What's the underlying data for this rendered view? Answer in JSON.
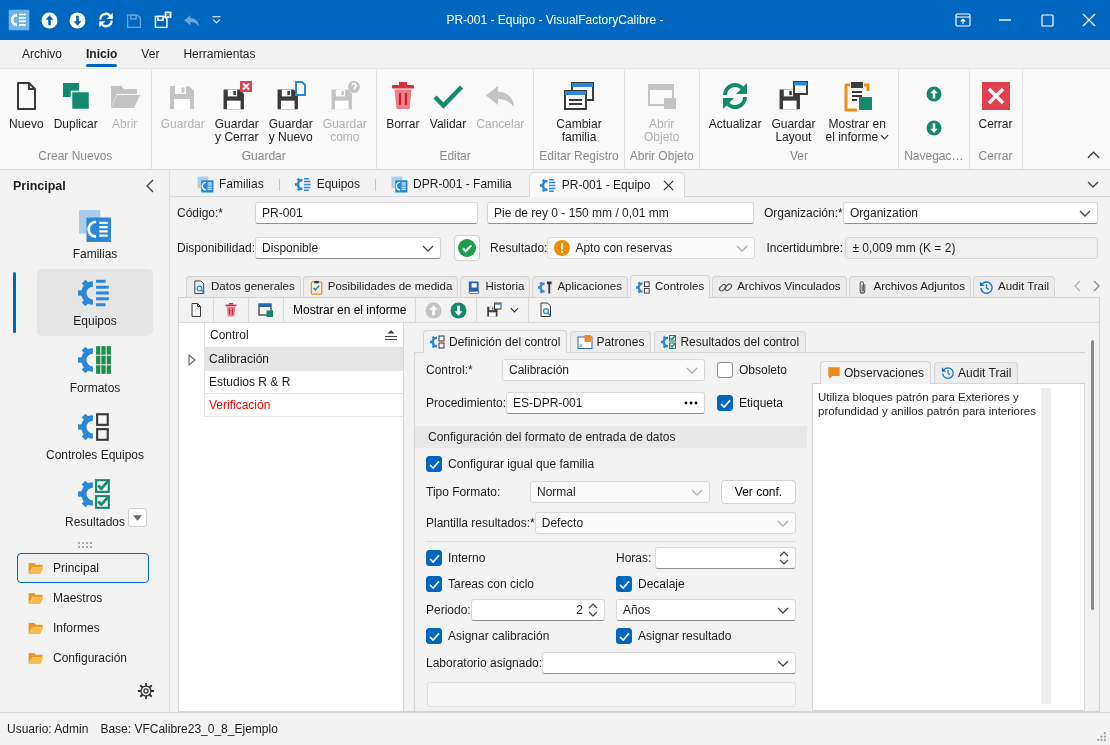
{
  "window": {
    "title": "PR-001 - Equipo - VisualFactoryCalibre -"
  },
  "quick_access": [
    {
      "kind": "app",
      "disabled": false
    },
    {
      "kind": "up",
      "disabled": false
    },
    {
      "kind": "down",
      "disabled": false
    },
    {
      "kind": "refresh",
      "disabled": false
    },
    {
      "kind": "save",
      "disabled": true
    },
    {
      "kind": "save_close",
      "disabled": false
    },
    {
      "kind": "undo",
      "disabled": true
    },
    {
      "kind": "customize",
      "disabled": false
    }
  ],
  "ribbon": {
    "tabs": [
      {
        "label": "Archivo",
        "selected": false
      },
      {
        "label": "Inicio",
        "selected": true
      },
      {
        "label": "Ver",
        "selected": false
      },
      {
        "label": "Herramientas",
        "selected": false
      }
    ],
    "groups": [
      {
        "label": "Crear Nuevos",
        "kind": "large",
        "buttons": [
          {
            "kind": "new",
            "label": "Nuevo",
            "disabled": false
          },
          {
            "kind": "duplicate",
            "label": "Duplicar",
            "disabled": false
          },
          {
            "kind": "open",
            "label": "Abrir",
            "disabled": true
          }
        ]
      },
      {
        "label": "Guardar",
        "kind": "large",
        "buttons": [
          {
            "kind": "save",
            "label": "Guardar",
            "disabled": true
          },
          {
            "kind": "save_close",
            "label": "Guardar y Cerrar",
            "disabled": false
          },
          {
            "kind": "save_new",
            "label": "Guardar y Nuevo",
            "disabled": false
          },
          {
            "kind": "save_as",
            "label": "Guardar como",
            "disabled": true
          }
        ]
      },
      {
        "label": "Editar",
        "kind": "large",
        "buttons": [
          {
            "kind": "delete",
            "label": "Borrar",
            "disabled": false
          },
          {
            "kind": "validate",
            "label": "Validar",
            "disabled": false
          },
          {
            "kind": "cancel",
            "label": "Cancelar",
            "disabled": true
          }
        ]
      },
      {
        "label": "Editar Registro",
        "kind": "large",
        "buttons": [
          {
            "kind": "change",
            "label": "Cambiar familia",
            "disabled": false
          }
        ]
      },
      {
        "label": "Abrir Objeto",
        "kind": "large",
        "buttons": [
          {
            "kind": "open_object",
            "label": "Abrir Objeto",
            "disabled": true
          }
        ]
      },
      {
        "label": "Ver",
        "kind": "large",
        "buttons": [
          {
            "kind": "refresh",
            "label": "Actualizar",
            "disabled": false
          },
          {
            "kind": "layout",
            "label": "Guardar Layout",
            "disabled": false
          },
          {
            "kind": "report",
            "label": "Mostrar en el informe",
            "disabled": false,
            "dropdown": true
          }
        ]
      },
      {
        "label": "Navegac…",
        "kind": "small",
        "buttons": [
          {
            "kind": "up",
            "disabled": false
          },
          {
            "kind": "down",
            "disabled": false
          }
        ]
      },
      {
        "label": "Cerrar",
        "kind": "large",
        "buttons": [
          {
            "kind": "close",
            "label": "Cerrar",
            "disabled": false
          }
        ]
      }
    ]
  },
  "sidebar": {
    "title": "Principal",
    "items": [
      {
        "kind": "familias",
        "label": "Familias",
        "selected": false
      },
      {
        "kind": "equipos",
        "label": "Equipos",
        "selected": true
      },
      {
        "kind": "formatos",
        "label": "Formatos",
        "selected": false
      },
      {
        "kind": "controles",
        "label": "Controles Equipos",
        "selected": false
      },
      {
        "kind": "resultados",
        "label": "Resultados",
        "selected": false
      }
    ],
    "groups": [
      {
        "label": "Principal",
        "selected": true
      },
      {
        "label": "Maestros",
        "selected": false
      },
      {
        "label": "Informes",
        "selected": false
      },
      {
        "label": "Configuración",
        "selected": false
      }
    ]
  },
  "doc_tabs": [
    {
      "kind": "familias",
      "label": "Familias",
      "selected": false
    },
    {
      "kind": "equipos",
      "label": "Equipos",
      "selected": false
    },
    {
      "kind": "familia_doc",
      "label": "DPR-001 - Familia",
      "selected": false
    },
    {
      "kind": "equipo_doc",
      "label": "PR-001 - Equipo",
      "selected": true
    }
  ],
  "form": {
    "code": {
      "label": "Código:*",
      "value": "PR-001",
      "disabled": false
    },
    "description": {
      "value": "Pie de rey 0 - 150 mm / 0,01 mm",
      "disabled": false
    },
    "organization": {
      "label": "Organización:*",
      "value": "Organization",
      "disabled": false
    },
    "availability": {
      "label": "Disponibilidad:",
      "value": "Disponible",
      "disabled": false
    },
    "result": {
      "label": "Resultado:",
      "value": "Apto con reservas",
      "disabled": true
    },
    "uncertainty": {
      "label": "Incertidumbre:",
      "value": "± 0,009 mm (K = 2)",
      "disabled": true
    }
  },
  "tabs": [
    {
      "kind": "general",
      "label": "Datos generales",
      "selected": false
    },
    {
      "kind": "medida",
      "label": "Posibilidades de medida",
      "selected": false
    },
    {
      "kind": "historia",
      "label": "Historia",
      "selected": false
    },
    {
      "kind": "aplicaciones",
      "label": "Aplicaciones",
      "selected": false
    },
    {
      "kind": "controles",
      "label": "Controles",
      "selected": true
    },
    {
      "kind": "vinculados",
      "label": "Archivos Vinculados",
      "selected": false
    },
    {
      "kind": "adjuntos",
      "label": "Archivos Adjuntos",
      "selected": false
    },
    {
      "kind": "audit",
      "label": "Audit Trail",
      "selected": false
    }
  ],
  "toolbar": [
    {
      "kind": "new",
      "disabled": false
    },
    {
      "kind": "delete",
      "disabled": false
    },
    {
      "kind": "window",
      "disabled": false
    },
    {
      "kind": "text",
      "label": "Mostrar en el informe",
      "disabled": false
    },
    {
      "kind": "up",
      "disabled": true
    },
    {
      "kind": "down",
      "disabled": false
    },
    {
      "kind": "layout",
      "disabled": false
    },
    {
      "kind": "preview",
      "disabled": false
    }
  ],
  "grid": {
    "columns": [
      {
        "label": "Control"
      }
    ],
    "rows": [
      {
        "label": "Calibración",
        "selected": true,
        "color": "#1e1e1e"
      },
      {
        "label": "Estudios R & R",
        "selected": false,
        "color": "#1e1e1e"
      },
      {
        "label": "Verificación",
        "selected": false,
        "color": "#ff0000"
      }
    ]
  },
  "inner_tabs": [
    {
      "kind": "definicion",
      "label": "Definición del control",
      "selected": true
    },
    {
      "kind": "patrones",
      "label": "Patrones",
      "selected": false
    },
    {
      "kind": "resultados",
      "label": "Resultados del control",
      "selected": false
    }
  ],
  "definition": {
    "control": {
      "label": "Control:*",
      "value": "Calibración",
      "disabled": true
    },
    "obsolete": {
      "label": "Obsoleto",
      "checked": false
    },
    "procedure": {
      "label": "Procedimiento:",
      "value": "ES-DPR-001"
    },
    "tag": {
      "label": "Etiqueta",
      "checked": true
    },
    "section": "Configuración del formato de entrada de datos",
    "same_as_family": {
      "label": "Configurar igual que familia",
      "checked": true
    },
    "format_type": {
      "label": "Tipo Formato:",
      "value": "Normal",
      "disabled": true
    },
    "view_config": {
      "label": "Ver conf."
    },
    "results_template": {
      "label": "Plantilla resultados:*",
      "value": "Defecto",
      "disabled": true
    },
    "internal": {
      "label": "Interno",
      "checked": true
    },
    "hours": {
      "label": "Horas:"
    },
    "cycle_tasks": {
      "label": "Tareas con ciclo",
      "checked": true
    },
    "offset": {
      "label": "Decalaje",
      "checked": true
    },
    "period": {
      "label": "Periodo:",
      "value": "2"
    },
    "period_unit": {
      "value": "Años",
      "disabled": false
    },
    "assign_calibration": {
      "label": "Asignar calibración",
      "checked": true
    },
    "assign_result": {
      "label": "Asignar resultado",
      "checked": true
    },
    "laboratory": {
      "label": "Laboratorio asignado:",
      "disabled": false
    }
  },
  "notes": {
    "tabs": [
      {
        "kind": "comments",
        "label": "Observaciones",
        "selected": true
      },
      {
        "kind": "audit",
        "label": "Audit Trail",
        "selected": false
      }
    ],
    "text": "Utiliza bloques patrón para Exteriores y profundidad y anillos patrón para interiores"
  },
  "status_bar": {
    "user": "Usuario: Admin",
    "database": "Base: VFCalibre23_0_8_Ejemplo"
  }
}
